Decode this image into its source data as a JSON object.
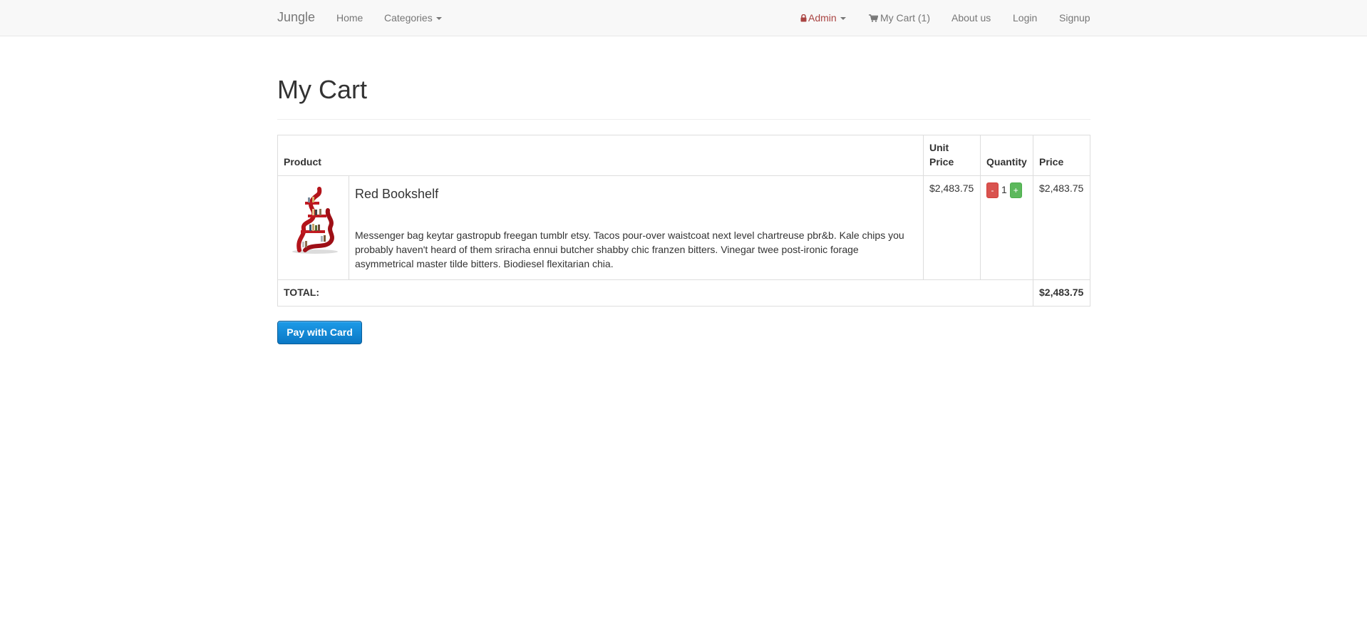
{
  "navbar": {
    "brand": "Jungle",
    "home": "Home",
    "categories": "Categories",
    "admin": "Admin",
    "cart": "My Cart (1)",
    "about": "About us",
    "login": "Login",
    "signup": "Signup"
  },
  "page": {
    "title": "My Cart"
  },
  "table": {
    "headers": {
      "product": "Product",
      "unit_price": "Unit Price",
      "quantity": "Quantity",
      "price": "Price"
    },
    "items": [
      {
        "name": "Red Bookshelf",
        "description": "Messenger bag keytar gastropub freegan tumblr etsy. Tacos pour-over waistcoat next level chartreuse pbr&b. Kale chips you probably haven't heard of them sriracha ennui butcher shabby chic franzen bitters. Vinegar twee post-ironic forage asymmetrical master tilde bitters. Biodiesel flexitarian chia.",
        "unit_price": "$2,483.75",
        "quantity": "1",
        "price": "$2,483.75",
        "decrement_label": "-",
        "increment_label": "+"
      }
    ],
    "total_label": "TOTAL:",
    "total_value": "$2,483.75"
  },
  "actions": {
    "pay_label": "Pay with Card"
  },
  "colors": {
    "admin": "#a94442",
    "danger": "#d9534f",
    "success": "#5cb85c",
    "pay": "#1785d6"
  },
  "icons": {
    "admin": "lock-icon",
    "cart": "shopping-cart-icon",
    "dropdown": "caret-down-icon"
  }
}
